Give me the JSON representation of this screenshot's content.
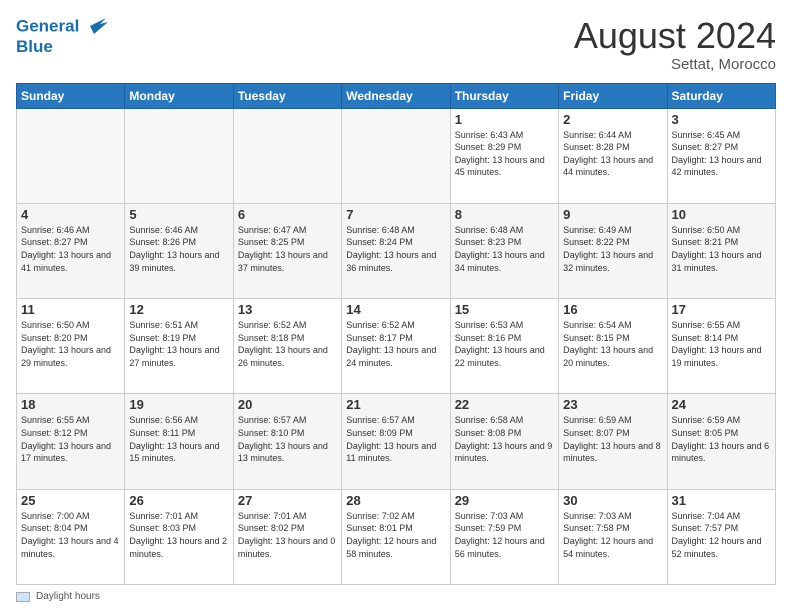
{
  "header": {
    "logo_line1": "General",
    "logo_line2": "Blue",
    "month_year": "August 2024",
    "location": "Settat, Morocco"
  },
  "footer": {
    "label": "Daylight hours"
  },
  "days_of_week": [
    "Sunday",
    "Monday",
    "Tuesday",
    "Wednesday",
    "Thursday",
    "Friday",
    "Saturday"
  ],
  "weeks": [
    [
      {
        "day": "",
        "info": ""
      },
      {
        "day": "",
        "info": ""
      },
      {
        "day": "",
        "info": ""
      },
      {
        "day": "",
        "info": ""
      },
      {
        "day": "1",
        "info": "Sunrise: 6:43 AM\nSunset: 8:29 PM\nDaylight: 13 hours and 45 minutes."
      },
      {
        "day": "2",
        "info": "Sunrise: 6:44 AM\nSunset: 8:28 PM\nDaylight: 13 hours and 44 minutes."
      },
      {
        "day": "3",
        "info": "Sunrise: 6:45 AM\nSunset: 8:27 PM\nDaylight: 13 hours and 42 minutes."
      }
    ],
    [
      {
        "day": "4",
        "info": "Sunrise: 6:46 AM\nSunset: 8:27 PM\nDaylight: 13 hours and 41 minutes."
      },
      {
        "day": "5",
        "info": "Sunrise: 6:46 AM\nSunset: 8:26 PM\nDaylight: 13 hours and 39 minutes."
      },
      {
        "day": "6",
        "info": "Sunrise: 6:47 AM\nSunset: 8:25 PM\nDaylight: 13 hours and 37 minutes."
      },
      {
        "day": "7",
        "info": "Sunrise: 6:48 AM\nSunset: 8:24 PM\nDaylight: 13 hours and 36 minutes."
      },
      {
        "day": "8",
        "info": "Sunrise: 6:48 AM\nSunset: 8:23 PM\nDaylight: 13 hours and 34 minutes."
      },
      {
        "day": "9",
        "info": "Sunrise: 6:49 AM\nSunset: 8:22 PM\nDaylight: 13 hours and 32 minutes."
      },
      {
        "day": "10",
        "info": "Sunrise: 6:50 AM\nSunset: 8:21 PM\nDaylight: 13 hours and 31 minutes."
      }
    ],
    [
      {
        "day": "11",
        "info": "Sunrise: 6:50 AM\nSunset: 8:20 PM\nDaylight: 13 hours and 29 minutes."
      },
      {
        "day": "12",
        "info": "Sunrise: 6:51 AM\nSunset: 8:19 PM\nDaylight: 13 hours and 27 minutes."
      },
      {
        "day": "13",
        "info": "Sunrise: 6:52 AM\nSunset: 8:18 PM\nDaylight: 13 hours and 26 minutes."
      },
      {
        "day": "14",
        "info": "Sunrise: 6:52 AM\nSunset: 8:17 PM\nDaylight: 13 hours and 24 minutes."
      },
      {
        "day": "15",
        "info": "Sunrise: 6:53 AM\nSunset: 8:16 PM\nDaylight: 13 hours and 22 minutes."
      },
      {
        "day": "16",
        "info": "Sunrise: 6:54 AM\nSunset: 8:15 PM\nDaylight: 13 hours and 20 minutes."
      },
      {
        "day": "17",
        "info": "Sunrise: 6:55 AM\nSunset: 8:14 PM\nDaylight: 13 hours and 19 minutes."
      }
    ],
    [
      {
        "day": "18",
        "info": "Sunrise: 6:55 AM\nSunset: 8:12 PM\nDaylight: 13 hours and 17 minutes."
      },
      {
        "day": "19",
        "info": "Sunrise: 6:56 AM\nSunset: 8:11 PM\nDaylight: 13 hours and 15 minutes."
      },
      {
        "day": "20",
        "info": "Sunrise: 6:57 AM\nSunset: 8:10 PM\nDaylight: 13 hours and 13 minutes."
      },
      {
        "day": "21",
        "info": "Sunrise: 6:57 AM\nSunset: 8:09 PM\nDaylight: 13 hours and 11 minutes."
      },
      {
        "day": "22",
        "info": "Sunrise: 6:58 AM\nSunset: 8:08 PM\nDaylight: 13 hours and 9 minutes."
      },
      {
        "day": "23",
        "info": "Sunrise: 6:59 AM\nSunset: 8:07 PM\nDaylight: 13 hours and 8 minutes."
      },
      {
        "day": "24",
        "info": "Sunrise: 6:59 AM\nSunset: 8:05 PM\nDaylight: 13 hours and 6 minutes."
      }
    ],
    [
      {
        "day": "25",
        "info": "Sunrise: 7:00 AM\nSunset: 8:04 PM\nDaylight: 13 hours and 4 minutes."
      },
      {
        "day": "26",
        "info": "Sunrise: 7:01 AM\nSunset: 8:03 PM\nDaylight: 13 hours and 2 minutes."
      },
      {
        "day": "27",
        "info": "Sunrise: 7:01 AM\nSunset: 8:02 PM\nDaylight: 13 hours and 0 minutes."
      },
      {
        "day": "28",
        "info": "Sunrise: 7:02 AM\nSunset: 8:01 PM\nDaylight: 12 hours and 58 minutes."
      },
      {
        "day": "29",
        "info": "Sunrise: 7:03 AM\nSunset: 7:59 PM\nDaylight: 12 hours and 56 minutes."
      },
      {
        "day": "30",
        "info": "Sunrise: 7:03 AM\nSunset: 7:58 PM\nDaylight: 12 hours and 54 minutes."
      },
      {
        "day": "31",
        "info": "Sunrise: 7:04 AM\nSunset: 7:57 PM\nDaylight: 12 hours and 52 minutes."
      }
    ]
  ]
}
